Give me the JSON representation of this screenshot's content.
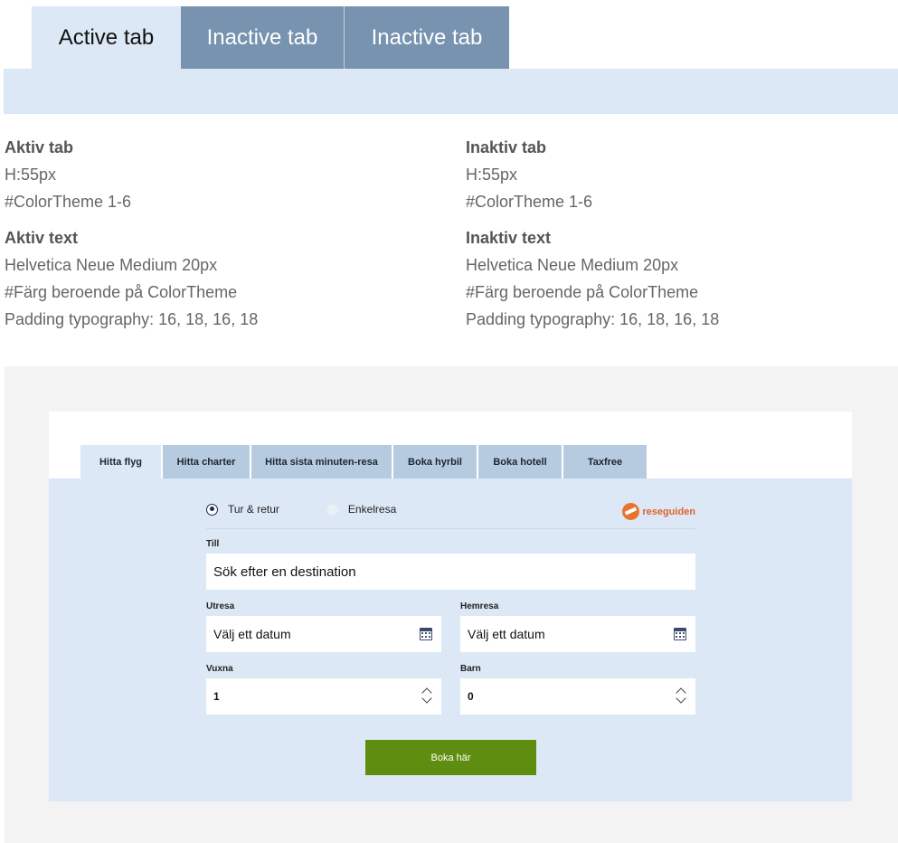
{
  "demo_tabs": {
    "active": "Active tab",
    "inactive": [
      "Inactive tab",
      "Inactive tab"
    ]
  },
  "spec": {
    "left": {
      "tab_heading": "Aktiv tab",
      "tab_height": "H:55px",
      "tab_color": "#ColorTheme 1-6",
      "text_heading": "Aktiv text",
      "text_font": "Helvetica Neue Medium 20px",
      "text_color": "#Färg beroende på ColorTheme",
      "text_padding": "Padding typography: 16, 18, 16, 18"
    },
    "right": {
      "tab_heading": "Inaktiv tab",
      "tab_height": "H:55px",
      "tab_color": "#ColorTheme 1-6",
      "text_heading": "Inaktiv text",
      "text_font": "Helvetica Neue Medium 20px",
      "text_color": "#Färg beroende på ColorTheme",
      "text_padding": "Padding typography: 16, 18, 16, 18"
    }
  },
  "widget": {
    "tabs": [
      "Hitta flyg",
      "Hitta charter",
      "Hitta sista minuten-resa",
      "Boka hyrbil",
      "Boka hotell",
      "Taxfree"
    ],
    "trip_type": {
      "round_trip": "Tur & retur",
      "one_way": "Enkelresa",
      "selected": "Tur & retur"
    },
    "brand": "reseguiden",
    "to": {
      "label": "Till",
      "placeholder": "Sök efter en destination"
    },
    "depart": {
      "label": "Utresa",
      "placeholder": "Välj ett datum"
    },
    "return": {
      "label": "Hemresa",
      "placeholder": "Välj ett datum"
    },
    "adults": {
      "label": "Vuxna",
      "value": "1"
    },
    "children": {
      "label": "Barn",
      "value": "0"
    },
    "submit": "Boka här"
  },
  "colors": {
    "active_tab": "#dce8f6",
    "inactive_tab": "#7793b0",
    "widget_inactive_tab": "#b7cbe0",
    "book_button": "#5f8d0f",
    "brand": "#e0612a"
  }
}
